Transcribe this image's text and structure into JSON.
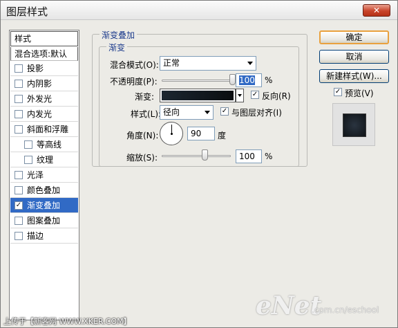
{
  "window": {
    "title": "图层样式",
    "close_glyph": "✕"
  },
  "style_list": {
    "header": "样式",
    "blend_options": "混合选项:默认",
    "items": [
      {
        "label": "投影",
        "checked": false,
        "sub": false,
        "selected": false
      },
      {
        "label": "内阴影",
        "checked": false,
        "sub": false,
        "selected": false
      },
      {
        "label": "外发光",
        "checked": false,
        "sub": false,
        "selected": false
      },
      {
        "label": "内发光",
        "checked": false,
        "sub": false,
        "selected": false
      },
      {
        "label": "斜面和浮雕",
        "checked": false,
        "sub": false,
        "selected": false
      },
      {
        "label": "等高线",
        "checked": false,
        "sub": true,
        "selected": false
      },
      {
        "label": "纹理",
        "checked": false,
        "sub": true,
        "selected": false
      },
      {
        "label": "光泽",
        "checked": false,
        "sub": false,
        "selected": false
      },
      {
        "label": "颜色叠加",
        "checked": false,
        "sub": false,
        "selected": false
      },
      {
        "label": "渐变叠加",
        "checked": true,
        "sub": false,
        "selected": true
      },
      {
        "label": "图案叠加",
        "checked": false,
        "sub": false,
        "selected": false
      },
      {
        "label": "描边",
        "checked": false,
        "sub": false,
        "selected": false
      }
    ]
  },
  "gradient_overlay": {
    "group_title": "渐变叠加",
    "subgroup_title": "渐变",
    "blend_mode_label": "混合模式(O):",
    "blend_mode_value": "正常",
    "opacity_label": "不透明度(P):",
    "opacity_value": "100",
    "opacity_unit": "%",
    "opacity_level": 1.0,
    "gradient_label": "渐变:",
    "reverse_label": "反向(R)",
    "reverse_checked": true,
    "style_label": "样式(L):",
    "style_value": "径向",
    "align_label": "与图层对齐(I)",
    "align_checked": true,
    "angle_label": "角度(N):",
    "angle_value": "90",
    "angle_unit": "度",
    "scale_label": "缩放(S):",
    "scale_value": "100",
    "scale_unit": "%",
    "scale_level": 0.5
  },
  "buttons": {
    "ok": "确定",
    "cancel": "取消",
    "new_style": "新建样式(W)...",
    "preview_label": "预览(V)",
    "preview_checked": true
  },
  "watermarks": {
    "left": "上传于【新客网 WWW.XKER.COM】",
    "brand": "eNet",
    "url": ".com.cn/eschool"
  },
  "colors": {
    "selection": "#316ac5",
    "group_title": "#1c3b8c",
    "default_button_border": "#e9a13e"
  }
}
